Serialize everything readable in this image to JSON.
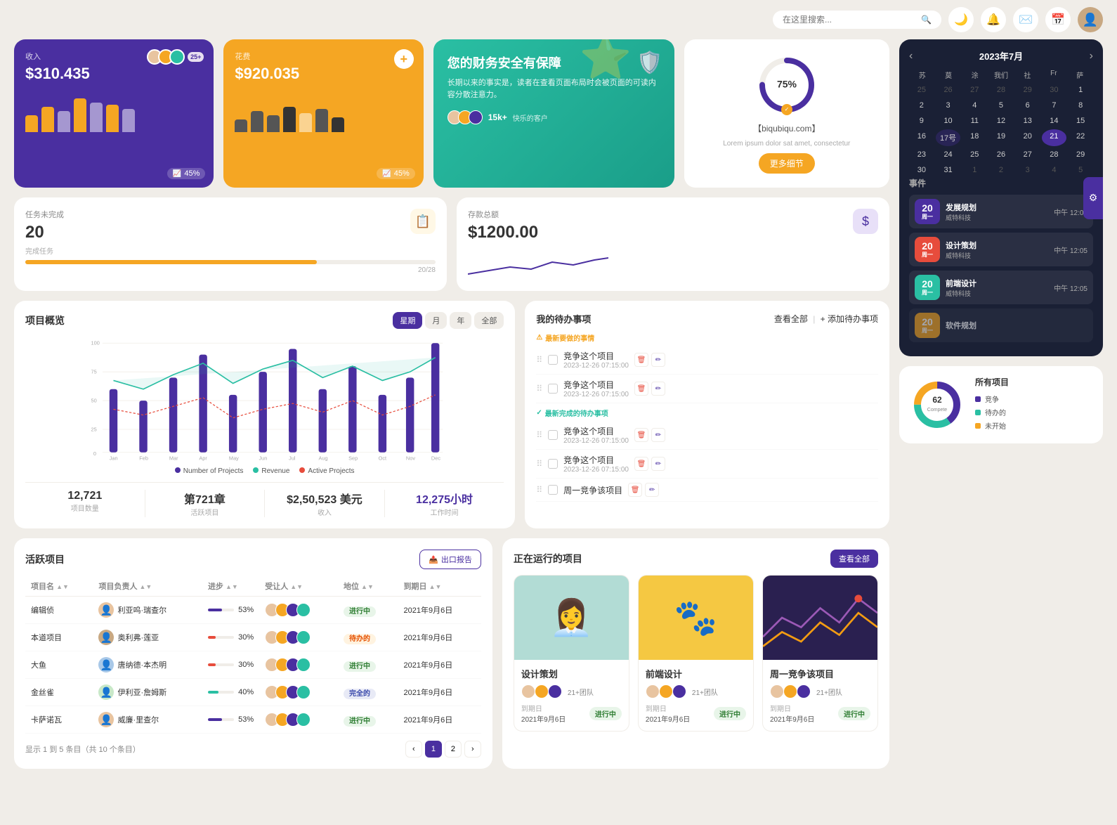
{
  "topbar": {
    "search_placeholder": "在这里搜索...",
    "icons": [
      "moon",
      "bell",
      "mail",
      "calendar",
      "user-avatar"
    ]
  },
  "cards": {
    "revenue": {
      "label": "收入",
      "amount": "$310.435",
      "percent": "45%",
      "bars": [
        40,
        60,
        45,
        70,
        55,
        65,
        50
      ]
    },
    "expenses": {
      "label": "花费",
      "amount": "$920.035",
      "percent": "45%",
      "bars": [
        30,
        50,
        40,
        60,
        45,
        55,
        35
      ]
    },
    "promo": {
      "title": "您的财务安全有保障",
      "desc": "长期以来的事实是，读者在查看页面布局时会被页面的可读内容分散注意力。",
      "customers": "15k+",
      "customers_label": "快乐的客户"
    },
    "circle": {
      "percent": 75,
      "domain": "【biqubiqu.com】",
      "desc": "Lorem ipsum dolor sat amet, consectetur",
      "btn_label": "更多细节"
    },
    "tasks": {
      "label": "任务未完成",
      "value": "20",
      "sub": "完成任务",
      "progress": "20/28",
      "progress_pct": 71
    },
    "savings": {
      "label": "存款总额",
      "value": "$1200.00"
    }
  },
  "project_overview": {
    "title": "项目概览",
    "tabs": [
      "星期",
      "月",
      "年",
      "全部"
    ],
    "active_tab": "星期",
    "x_labels": [
      "Jan",
      "Feb",
      "Mar",
      "Apr",
      "May",
      "Jun",
      "Jul",
      "Aug",
      "Sep",
      "Oct",
      "Nov",
      "Dec"
    ],
    "bars": [
      55,
      42,
      68,
      85,
      45,
      70,
      90,
      55,
      75,
      48,
      65,
      95
    ],
    "legend": [
      "Number of Projects",
      "Revenue",
      "Active Projects"
    ],
    "stats": [
      {
        "value": "12,721",
        "label": "项目数量"
      },
      {
        "value": "第721章",
        "label": "活跃项目"
      },
      {
        "value": "$2,50,523 美元",
        "label": "收入"
      },
      {
        "value": "12,275小时",
        "label": "工作时间"
      }
    ]
  },
  "todo": {
    "title": "我的待办事项",
    "view_all": "查看全部",
    "add_btn": "+ 添加待办事项",
    "urgent_title": "最新要做的事情",
    "recent_title": "最新完成的待办事项",
    "items_urgent": [
      {
        "text": "竞争这个项目",
        "date": "2023-12-26 07:15:00"
      },
      {
        "text": "竞争这个项目",
        "date": "2023-12-26 07:15:00"
      },
      {
        "text": "竞争这个项目",
        "date": "2023-12-26 07:15:00"
      }
    ],
    "items_recent": [
      {
        "text": "竞争这个项目",
        "date": "2023-12-26 07:15:00"
      },
      {
        "text": "周一竞争该项目",
        "date": ""
      }
    ]
  },
  "active_projects": {
    "title": "活跃项目",
    "export_label": "出口报告",
    "columns": [
      "项目名称",
      "项目负责人",
      "进步",
      "受让人",
      "地位",
      "到期日"
    ],
    "rows": [
      {
        "name": "编辑侦",
        "owner": "利亚呜·瑞查尔",
        "progress": 53,
        "color": "#4a2fa0",
        "assignees": 4,
        "status": "进行中",
        "status_class": "active",
        "due": "2021年9月6日"
      },
      {
        "name": "本道项目",
        "owner": "奥利弗·莲亚",
        "progress": 30,
        "color": "#e74c3c",
        "assignees": 4,
        "status": "待办的",
        "status_class": "waiting",
        "due": "2021年9月6日"
      },
      {
        "name": "大鱼",
        "owner": "唐纳德·本杰明",
        "progress": 30,
        "color": "#e74c3c",
        "assignees": 4,
        "status": "进行中",
        "status_class": "active",
        "due": "2021年9月6日"
      },
      {
        "name": "金丝雀",
        "owner": "伊利亚·詹姆斯",
        "progress": 40,
        "color": "#2abfa3",
        "assignees": 4,
        "status": "完全的",
        "status_class": "complete",
        "due": "2021年9月6日"
      },
      {
        "name": "卡萨诺瓦",
        "owner": "威廉·里查尔",
        "progress": 53,
        "color": "#4a2fa0",
        "assignees": 4,
        "status": "进行中",
        "status_class": "active",
        "due": "2021年9月6日"
      }
    ],
    "pagination": {
      "show": "显示 1 到 5 条目（共 10 个条目）",
      "pages": [
        1,
        2
      ]
    }
  },
  "running_projects": {
    "title": "正在运行的项目",
    "view_all": "查看全部",
    "projects": [
      {
        "name": "设计策划",
        "bg": "#b2dcd5",
        "emoji": "👩‍💼",
        "team": "21+团队",
        "due": "2021年9月6日",
        "status": "进行中",
        "status_class": "active"
      },
      {
        "name": "前端设计",
        "bg": "#f5a623",
        "emoji": "🐾",
        "team": "21+团队",
        "due": "2021年9月6日",
        "status": "进行中",
        "status_class": "active"
      },
      {
        "name": "周一竞争该项目",
        "bg": "#2a2050",
        "emoji": "〰",
        "team": "21+团队",
        "due": "2021年9月6日",
        "status": "进行中",
        "status_class": "active"
      }
    ]
  },
  "calendar": {
    "title": "2023年7月",
    "day_labels": [
      "苏",
      "莫",
      "涂",
      "我们",
      "社",
      "Fr",
      "萨"
    ],
    "prev_days": [
      25,
      26,
      27,
      28,
      29,
      30,
      1
    ],
    "weeks": [
      [
        2,
        3,
        4,
        5,
        6,
        7,
        8
      ],
      [
        9,
        10,
        11,
        12,
        13,
        14,
        15
      ],
      [
        16,
        17,
        18,
        19,
        20,
        21,
        22
      ],
      [
        23,
        24,
        25,
        26,
        27,
        28,
        29
      ],
      [
        30,
        31,
        1,
        2,
        3,
        4,
        5
      ]
    ],
    "today": 21,
    "highlighted": [
      17
    ]
  },
  "events": {
    "title": "事件",
    "items": [
      {
        "day": "20",
        "weekday": "周一",
        "name": "发展规划",
        "company": "威特科技",
        "time": "中午 12:05",
        "color": "#4a2fa0"
      },
      {
        "day": "20",
        "weekday": "周一",
        "name": "设计策划",
        "company": "威特科技",
        "time": "中午 12:05",
        "color": "#e74c3c"
      },
      {
        "day": "20",
        "weekday": "周一",
        "name": "前端设计",
        "company": "威特科技",
        "time": "中午 12:05",
        "color": "#2abfa3"
      },
      {
        "day": "20",
        "weekday": "周一-",
        "name": "软件规划",
        "company": "",
        "time": "",
        "color": "#f5a623"
      }
    ]
  },
  "donut": {
    "title": "所有项目",
    "value": "62",
    "value_label": "Compete",
    "segments": [
      {
        "label": "竞争",
        "color": "#4a2fa0",
        "pct": 40
      },
      {
        "label": "待办的",
        "color": "#2abfa3",
        "pct": 35
      },
      {
        "label": "未开始",
        "color": "#f5a623",
        "pct": 25
      }
    ]
  }
}
